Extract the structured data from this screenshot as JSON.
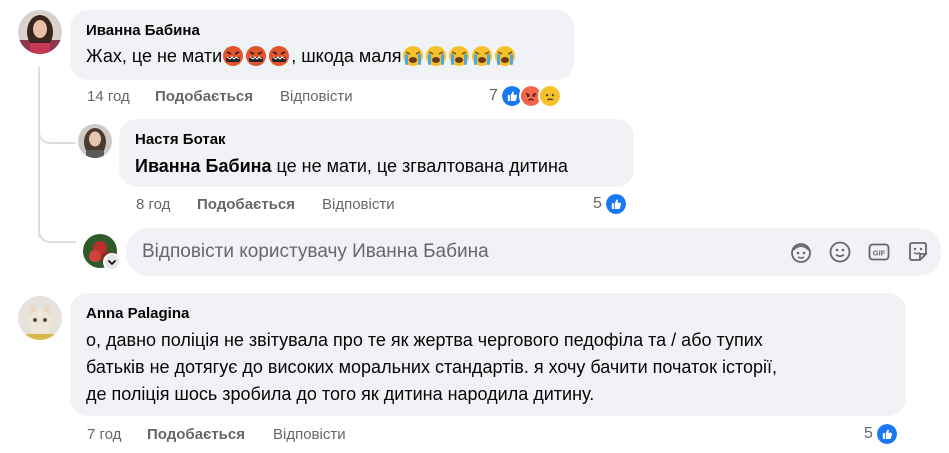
{
  "comments": [
    {
      "author": "Иванна Бабина",
      "text_before": "Жах, це не мати",
      "text_middle": ", шкода маля",
      "time": "14 год",
      "like": "Подобається",
      "reply": "Відповісти",
      "reaction_count": "7"
    },
    {
      "author": "Настя Ботак",
      "mention": "Иванна Бабина",
      "text": " це не мати, це згвалтована дитина",
      "time": "8 год",
      "like": "Подобається",
      "reply": "Відповісти",
      "reaction_count": "5"
    },
    {
      "author": "Anna Palagina",
      "lines": [
        "о, давно поліція не звітувала про те як жертва чергового педофіла та / або тупих",
        "батьків не дотягує до високих моральних стандартів. я хочу бачити початок історії,",
        "де поліція шось зробила до того як дитина народила дитину."
      ],
      "time": "7 год",
      "like": "Подобається",
      "reply": "Відповісти",
      "reaction_count": "5"
    }
  ],
  "reply_box": {
    "placeholder": "Відповісти користувачу Иванна Бабина"
  },
  "icons": {
    "emoji_angry": "face-with-symbols-on-mouth",
    "emoji_cry": "loudly-crying-face",
    "reactions": [
      "like",
      "angry",
      "sad"
    ],
    "reply_tools": [
      "avatar-sticker-icon",
      "emoji-icon",
      "gif-icon",
      "sticker-icon"
    ]
  },
  "colors": {
    "like_blue": "#1877f2",
    "bubble_bg": "#f0f2f5",
    "meta_text": "#65676b"
  }
}
